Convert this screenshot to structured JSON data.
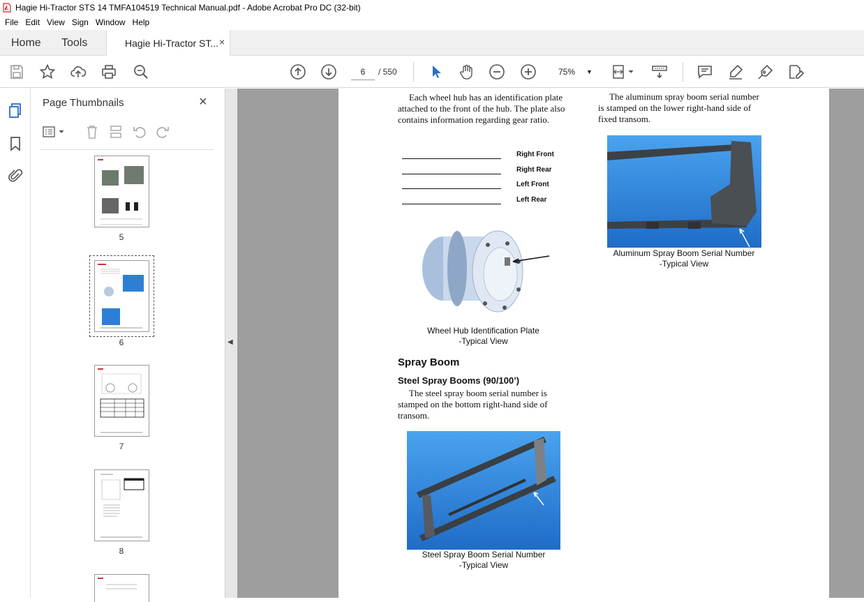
{
  "window": {
    "title": "Hagie Hi-Tractor STS 14 TMFA104519 Technical Manual.pdf - Adobe Acrobat Pro DC (32-bit)"
  },
  "menu": [
    "File",
    "Edit",
    "View",
    "Sign",
    "Window",
    "Help"
  ],
  "tabs": {
    "home": "Home",
    "tools": "Tools",
    "document": "Hagie Hi-Tractor ST...",
    "close": "×"
  },
  "toolbar": {
    "page_current": "6",
    "page_total": "/ 550",
    "zoom": "75%",
    "zoom_caret": "▼"
  },
  "panel": {
    "title": "Page Thumbnails",
    "close": "×",
    "thumbnails": [
      "5",
      "6",
      "7",
      "8"
    ]
  },
  "splitter_arrow": "◀",
  "page_content": {
    "wheel_hub_text": [
      "Each wheel hub has an identification plate",
      "attached to the front of the hub. The plate also",
      "contains information regarding gear ratio."
    ],
    "hub_labels": [
      "Right Front",
      "Right Rear",
      "Left Front",
      "Left Rear"
    ],
    "hub_caption_1": "Wheel Hub Identification Plate",
    "hub_caption_2": "-Typical View",
    "spray_boom_heading": "Spray Boom",
    "steel_heading": "Steel Spray Booms (90/100’)",
    "steel_text": [
      "The steel spray boom serial number is",
      "stamped on the bottom right-hand side of",
      "transom."
    ],
    "steel_caption_1": "Steel Spray Boom Serial Number",
    "steel_caption_2": "-Typical View",
    "aluminum_text": [
      "The aluminum spray boom serial number",
      "is stamped on the lower right-hand side of",
      "fixed transom."
    ],
    "aluminum_caption_1": "Aluminum Spray Boom Serial Number",
    "aluminum_caption_2": "-Typical View"
  },
  "colors": {
    "accent_blue": "#2a6ec7",
    "photo_blue": "#2d7fd6",
    "pdf_red": "#d4232a"
  }
}
